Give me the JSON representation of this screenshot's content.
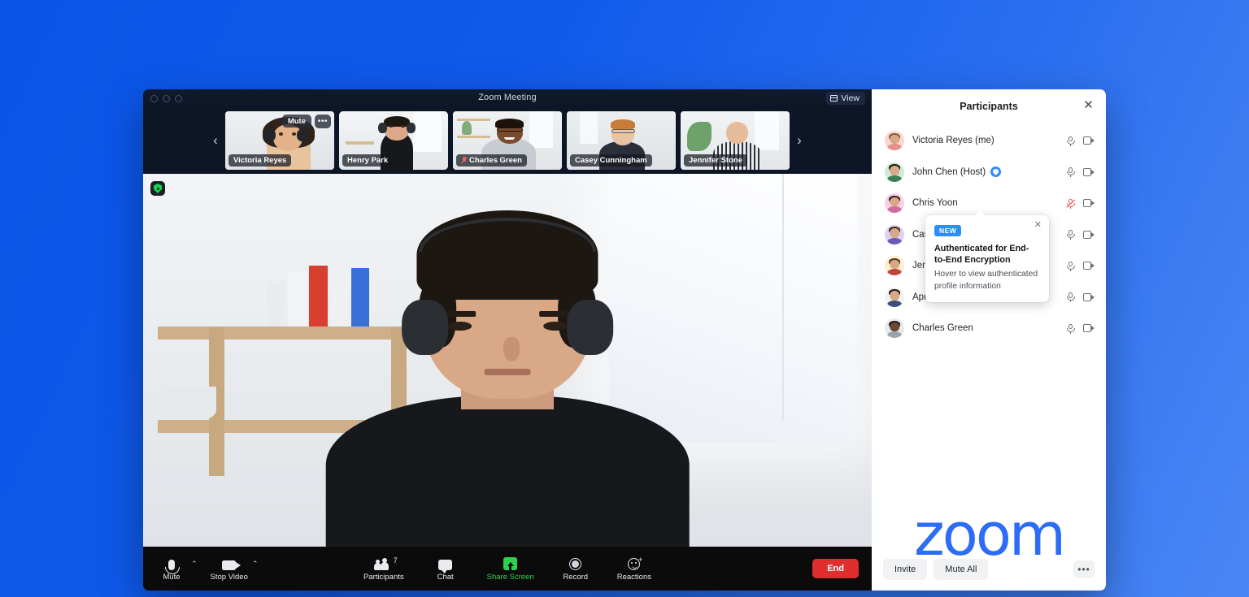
{
  "window": {
    "title": "Zoom Meeting",
    "view_button": "View",
    "view_icon": "grid-view-icon",
    "traffic_lights": [
      "close",
      "minimize",
      "maximize"
    ]
  },
  "filmstrip": {
    "prev_arrow": "‹",
    "next_arrow": "›",
    "thumbnails": [
      {
        "name": "Victoria Reyes",
        "active": false,
        "muted": false,
        "hover_mute_label": "Mute",
        "more_label": "•••"
      },
      {
        "name": "Henry Park",
        "active": true,
        "muted": false
      },
      {
        "name": "Charles Green",
        "active": false,
        "muted": true
      },
      {
        "name": "Casey Cunningham",
        "active": false,
        "muted": false
      },
      {
        "name": "Jennifer Stone",
        "active": false,
        "muted": false
      }
    ]
  },
  "stage": {
    "encryption_badge": "end-to-end-encryption-shield",
    "speaker": "Henry Park"
  },
  "toolbar": {
    "left": [
      {
        "label": "Mute",
        "icon": "microphone-icon",
        "has_caret": true
      },
      {
        "label": "Stop Video",
        "icon": "video-camera-icon",
        "has_caret": true
      }
    ],
    "center": [
      {
        "label": "Participants",
        "icon": "people-icon",
        "badge": "7",
        "highlight": false
      },
      {
        "label": "Chat",
        "icon": "chat-bubble-icon",
        "highlight": false
      },
      {
        "label": "Share Screen",
        "icon": "share-screen-icon",
        "highlight": true
      },
      {
        "label": "Record",
        "icon": "record-circle-icon",
        "highlight": false
      },
      {
        "label": "Reactions",
        "icon": "reactions-smiley-icon",
        "highlight": false
      }
    ],
    "end_label": "End"
  },
  "panel": {
    "title": "Participants",
    "close_icon": "close-icon",
    "participants": [
      {
        "name": "Victoria Reyes (me)",
        "authenticated": false,
        "muted": false,
        "avatar_bg": "#f9d8d3",
        "hair": "#8a5a3a",
        "body": "#e5908a"
      },
      {
        "name": "John Chen (Host)",
        "authenticated": true,
        "muted": false,
        "avatar_bg": "#cdecd8",
        "hair": "#1f1a15",
        "body": "#3a7f55"
      },
      {
        "name": "Chris Yoon",
        "authenticated": false,
        "muted": true,
        "avatar_bg": "#f8cfe3",
        "hair": "#2a211a",
        "body": "#d06ba0"
      },
      {
        "name": "Casey Cunningham",
        "authenticated": false,
        "muted": false,
        "avatar_bg": "#ddd2f6",
        "hair": "#3a2a1e",
        "body": "#6f57b8"
      },
      {
        "name": "Jennifer Stone",
        "authenticated": false,
        "muted": false,
        "avatar_bg": "#fdf0d0",
        "hair": "#5a3422",
        "body": "#c1453c"
      },
      {
        "name": "April Williams",
        "authenticated": true,
        "muted": false,
        "avatar_bg": "#f2f3f5",
        "hair": "#241a14",
        "body": "#3a4f73"
      },
      {
        "name": "Charles Green",
        "authenticated": false,
        "muted": false,
        "avatar_bg": "#e8e9ec",
        "hair": "#241a14",
        "body": "#9aa4ae"
      }
    ],
    "tooltip": {
      "badge": "NEW",
      "title": "Authenticated for End-to-End Encryption",
      "body": "Hover to view authenticated profile information",
      "close_icon": "close-icon"
    },
    "logo": "zoom",
    "footer": {
      "invite_label": "Invite",
      "mute_all_label": "Mute All",
      "more_label": "•••"
    }
  },
  "colors": {
    "brand_blue": "#2d6cf6",
    "accent_blue": "#2d8cff",
    "share_green": "#2fd04d",
    "active_green": "#33cc5a",
    "end_red": "#e02d2d",
    "mute_red": "#e05c5c",
    "panel_bg": "#ffffff",
    "toolbar_bg": "#0b0b0c",
    "meeting_bg": "#0d1627"
  }
}
